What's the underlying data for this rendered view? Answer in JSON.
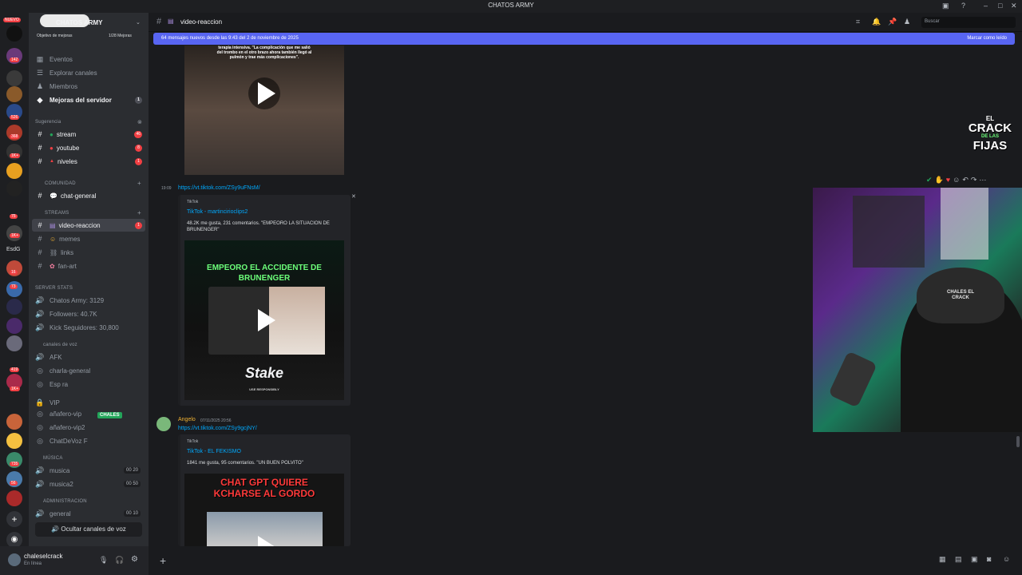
{
  "window": {
    "title": "CHATOS ARMY"
  },
  "servers": {
    "new_label": "NUEVO",
    "badges": [
      "142",
      "526",
      "368",
      "1K+",
      "75",
      "1K+",
      "16",
      "73",
      "419",
      "1K+",
      "735",
      "56"
    ],
    "text_icon": "EsdG"
  },
  "server": {
    "name": "CHATOS ARMY",
    "boost_goal": "Objetivo de mejoras",
    "boost_count": "1/28 Mejoras"
  },
  "nav": {
    "events": "Eventos",
    "explore": "Explorar canales",
    "members": "Miembros",
    "boosts": "Mejoras del servidor",
    "boosts_badge": "1"
  },
  "suggestion": {
    "label": "Sugerencia",
    "stream": "stream",
    "stream_badge": "46",
    "youtube": "youtube",
    "youtube_badge": "8",
    "niveles": "niveles",
    "niveles_badge": "1"
  },
  "community": {
    "label": "COMUNIDAD",
    "chat_general": "chat-general"
  },
  "streams": {
    "label": "STREAMS",
    "video_reaccion": "video-reaccion",
    "video_badge": "1",
    "memes": "memes",
    "links": "links",
    "fan_art": "fan-art"
  },
  "server_stats": {
    "label": "SERVER STATS",
    "chatos": "Chatos Army: 3129",
    "followers": "Followers: 40.7K",
    "kick": "Kick Seguidores: 30,800"
  },
  "voice": {
    "label": "canales de voz",
    "afk": "AFK",
    "charla": "charla-general",
    "espera": "Esp  ra",
    "vip": "VIP",
    "anafero_vip": "añafero-vip",
    "chales_tag": "CHALES",
    "anafero_vip2": "añafero-vip2",
    "chatdevoz": "ChatDeVoz F"
  },
  "music": {
    "label": "MÚSICA",
    "musica": "musica",
    "musica_count": "00 20",
    "musica2": "musica2",
    "musica2_count": "00 50"
  },
  "admin": {
    "label": "ADMINISTRACION",
    "general": "general",
    "general_count": "00 10"
  },
  "hide_voice": "Ocultar canales de voz",
  "user": {
    "name": "chaleselcrack",
    "status": "En línea"
  },
  "channel": {
    "name": "video-reaccion",
    "search_placeholder": "Buscar"
  },
  "new_messages": {
    "text": "64 mensajes nuevos desde las 9:43 del 2 de noviembre de 2025",
    "mark_read": "Marcar como leído"
  },
  "messages": {
    "video1_caption": "terapia intensiva. \"La complicación que me salió del trombo en el otro brazo ahora también llegó al pulmón y trae más complicaciones\".",
    "msg2_time": "19:09",
    "msg2_link": "https://vt.tiktok.com/ZSy9uFNsM/",
    "embed2_provider": "TikTok",
    "embed2_title": "TikTok - martincirioclips2",
    "embed2_desc": "48.2K me gusta, 231 comentarios. \"EMPEORO LA SITUACION DE BRUNENGER\"",
    "video2_title": "EMPEORO EL ACCIDENTE DE BRUNENGER",
    "video2_brand": "Stake",
    "video2_brand_sub": "USE RESPONSIBLY",
    "msg3_author": "Angelo",
    "msg3_time": "07/11/2025 20:56",
    "msg3_link": "https://vt.tiktok.com/ZSy9gcjNY/",
    "embed3_provider": "TikTok",
    "embed3_title": "TikTok - EL FEKISMO",
    "embed3_desc": "1841 me gusta, 95 comentarios. \"UN BUEN POLVITO\"",
    "video3_title": "CHAT GPT QUIERE KCHARSE AL GORDO"
  },
  "overlay": {
    "logo_line1": "EL",
    "logo_line2": "CRACK",
    "logo_line3": "DE LAS",
    "logo_line4": "FIJAS",
    "cap_text": "CHALES EL CRACK"
  },
  "colors": {
    "accent": "#5865f2",
    "link": "#00a8fc",
    "badge": "#f23f43",
    "chales_tag": "#23a55a"
  }
}
